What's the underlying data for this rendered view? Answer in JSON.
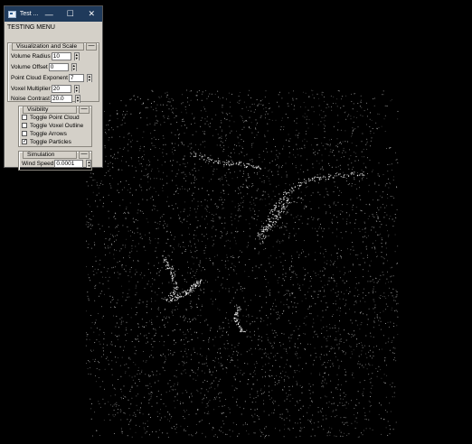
{
  "window": {
    "title": "Test ...",
    "menu_title": "TESTING MENU"
  },
  "titlebar_buttons": {
    "minimize": "—",
    "maximize": "☐",
    "close": "✕"
  },
  "panels": {
    "viz": {
      "label": "Visualization and Scale",
      "collapse": "—",
      "fields": [
        {
          "label": "Volume Radius",
          "value": "10"
        },
        {
          "label": "Volume Offset",
          "value": "0"
        },
        {
          "label": "Point Cloud Exponent",
          "value": "7"
        },
        {
          "label": "Voxel Multiplier",
          "value": "20"
        },
        {
          "label": "Noise Contrast",
          "value": "20.0"
        }
      ]
    },
    "visibility": {
      "label": "Visibility",
      "collapse": "—",
      "options": [
        {
          "label": "Toggle Point Cloud",
          "checked": false
        },
        {
          "label": "Toggle Voxel Outline",
          "checked": false
        },
        {
          "label": "Toggle Arrows",
          "checked": false
        },
        {
          "label": "Toggle Particles",
          "checked": true
        }
      ]
    },
    "simulation": {
      "label": "Simulation",
      "collapse": "—",
      "fields": [
        {
          "label": "Wind Speed",
          "value": "0.0001"
        }
      ]
    }
  },
  "icons": {
    "spin_up": "▲",
    "spin_down": "▼",
    "check": "✓"
  },
  "colors": {
    "background": "#000000",
    "particles": "#ffffff",
    "titlebar": "#1f3a5b",
    "panel": "#d4d0c8"
  }
}
